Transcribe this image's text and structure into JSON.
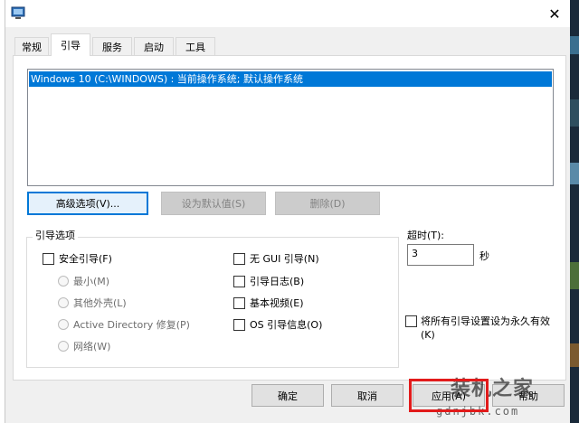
{
  "tabs": [
    {
      "label": "常规",
      "active": false
    },
    {
      "label": "引导",
      "active": true
    },
    {
      "label": "服务",
      "active": false
    },
    {
      "label": "启动",
      "active": false
    },
    {
      "label": "工具",
      "active": false
    }
  ],
  "os_list": {
    "items": [
      "Windows 10 (C:\\WINDOWS) : 当前操作系统; 默认操作系统"
    ]
  },
  "list_buttons": {
    "advanced": "高级选项(V)...",
    "set_default": "设为默认值(S)",
    "delete": "删除(D)"
  },
  "boot_options": {
    "title": "引导选项",
    "safe_boot": "安全引导(F)",
    "radios": [
      "最小(M)",
      "其他外壳(L)",
      "Active Directory 修复(P)",
      "网络(W)"
    ],
    "right_checks": [
      "无 GUI 引导(N)",
      "引导日志(B)",
      "基本视频(E)",
      "OS 引导信息(O)"
    ]
  },
  "timeout": {
    "label": "超时(T):",
    "value": "3",
    "unit": "秒"
  },
  "permanent": {
    "label_line1": "将所有引导设置设为永久有效",
    "label_line2": "(K)"
  },
  "footer": {
    "ok": "确定",
    "cancel": "取消",
    "apply": "应用(A)",
    "help": "帮助"
  },
  "watermark": {
    "text": "装机之家",
    "url": "gdnjbk.com"
  },
  "colors": {
    "selection": "#0078d7",
    "highlight_box": "#e21b1b"
  }
}
